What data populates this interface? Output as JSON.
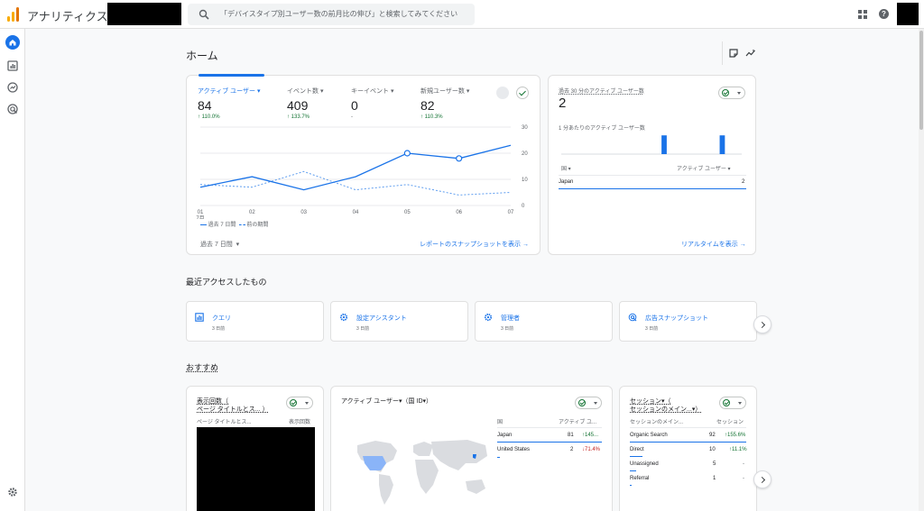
{
  "app": {
    "title": "アナリティクス",
    "search_placeholder": "「デバイスタイプ別ユーザー数の前月比の伸び」と検索してみてください",
    "brand_colors": {
      "logo_dark": "#e37400",
      "logo_light": "#f9ab00",
      "accent": "#1a73e8",
      "positive": "#137333"
    }
  },
  "icons": {
    "rail": [
      "home-icon",
      "reports-icon",
      "explore-icon",
      "advertising-icon",
      "settings-icon"
    ],
    "header": [
      "apps-icon",
      "help-icon",
      "notes-icon",
      "insights-icon"
    ]
  },
  "page": {
    "title": "ホーム"
  },
  "overview": {
    "metrics": [
      {
        "label": "アクティブ ユーザー",
        "value": "84",
        "change": "↑ 110.0%"
      },
      {
        "label": "イベント数",
        "value": "409",
        "change": "↑ 133.7%"
      },
      {
        "label": "キーイベント",
        "value": "0",
        "change": "-"
      },
      {
        "label": "新規ユーザー数",
        "value": "82",
        "change": "↑ 110.3%"
      }
    ],
    "legend": {
      "current": "過去 7 日間",
      "previous": "前の期間"
    },
    "date_range": "過去 7 日間",
    "link": "レポートのスナップショットを表示 →"
  },
  "chart_data": {
    "type": "line",
    "x": [
      "01\n7月",
      "02",
      "03",
      "04",
      "05",
      "06",
      "07"
    ],
    "x_labels": [
      "01",
      "02",
      "03",
      "04",
      "05",
      "06",
      "07"
    ],
    "x_sublabel": "7月",
    "series": [
      {
        "name": "過去 7 日間",
        "values": [
          7,
          11,
          6,
          11,
          20,
          18,
          23
        ]
      },
      {
        "name": "前の期間",
        "values": [
          8,
          7,
          13,
          6,
          8,
          4,
          5
        ]
      }
    ],
    "y_ticks": [
      0,
      10,
      20,
      30
    ],
    "ylim": [
      0,
      30
    ],
    "grid": true,
    "legend_position": "bottom-left"
  },
  "realtime": {
    "title": "過去 30 分のアクティブ ユーザー数",
    "value": "2",
    "sub": "1 分あたりのアクティブ ユーザー数",
    "bars": [
      0,
      0,
      0,
      0,
      0,
      0,
      0,
      0,
      0,
      0,
      0,
      0,
      0,
      0,
      0,
      0,
      0,
      0,
      0,
      0,
      0,
      0,
      0,
      0,
      0,
      0,
      0,
      0,
      0,
      0,
      0,
      0,
      0,
      0,
      0,
      0,
      0,
      0,
      0,
      0,
      0,
      0,
      0,
      0,
      0,
      0,
      0,
      0,
      0,
      0,
      1,
      0,
      0,
      0,
      0,
      0,
      0,
      0,
      0,
      0,
      0,
      0,
      0,
      0,
      0,
      0,
      0,
      0,
      0,
      0,
      0,
      0,
      0,
      0,
      0,
      0,
      0,
      0,
      0,
      1,
      0,
      0,
      0,
      0,
      0,
      0,
      0,
      0,
      0,
      0
    ],
    "col_country": "国",
    "col_users": "アクティブ ユーザー",
    "rows": [
      {
        "country": "Japan",
        "users": "2"
      }
    ],
    "link": "リアルタイムを表示 →"
  },
  "recent": {
    "title": "最近アクセスしたもの",
    "items": [
      {
        "name": "クエリ",
        "sub": "3 日前",
        "icon": "query-icon"
      },
      {
        "name": "設定アシスタント",
        "sub": "3 日前",
        "icon": "settings-assistant-icon"
      },
      {
        "name": "管理者",
        "sub": "3 日前",
        "icon": "admin-icon"
      },
      {
        "name": "広告スナップショット",
        "sub": "3 日前",
        "icon": "ads-snapshot-icon"
      }
    ]
  },
  "recommended": {
    "title": "おすすめ",
    "card1": {
      "title_l1": "表示回数（",
      "title_l2": "ページ タイトルとス... ）",
      "col1": "ページ タイトルとス...",
      "col2": "表示回数"
    },
    "card2": {
      "title": "アクティブ ユーザー▾（国 ID▾）",
      "col1": "国",
      "col2": "アクティブ ユ...",
      "rows": [
        {
          "country": "Japan",
          "users": "81",
          "change": "↑145..."
        },
        {
          "country": "United States",
          "users": "2",
          "change": "↓71.4%"
        }
      ]
    },
    "card3": {
      "title_l1": "セッション▾（",
      "title_l2": "セッションのメイン...▾）",
      "col1": "セッションのメイン...",
      "col2": "セッション",
      "rows": [
        {
          "name": "Organic Search",
          "value": "92",
          "change": "↑155.6%"
        },
        {
          "name": "Direct",
          "value": "10",
          "change": "↑11.1%"
        },
        {
          "name": "Unassigned",
          "value": "5",
          "change": "-"
        },
        {
          "name": "Referral",
          "value": "1",
          "change": "-"
        }
      ]
    }
  }
}
